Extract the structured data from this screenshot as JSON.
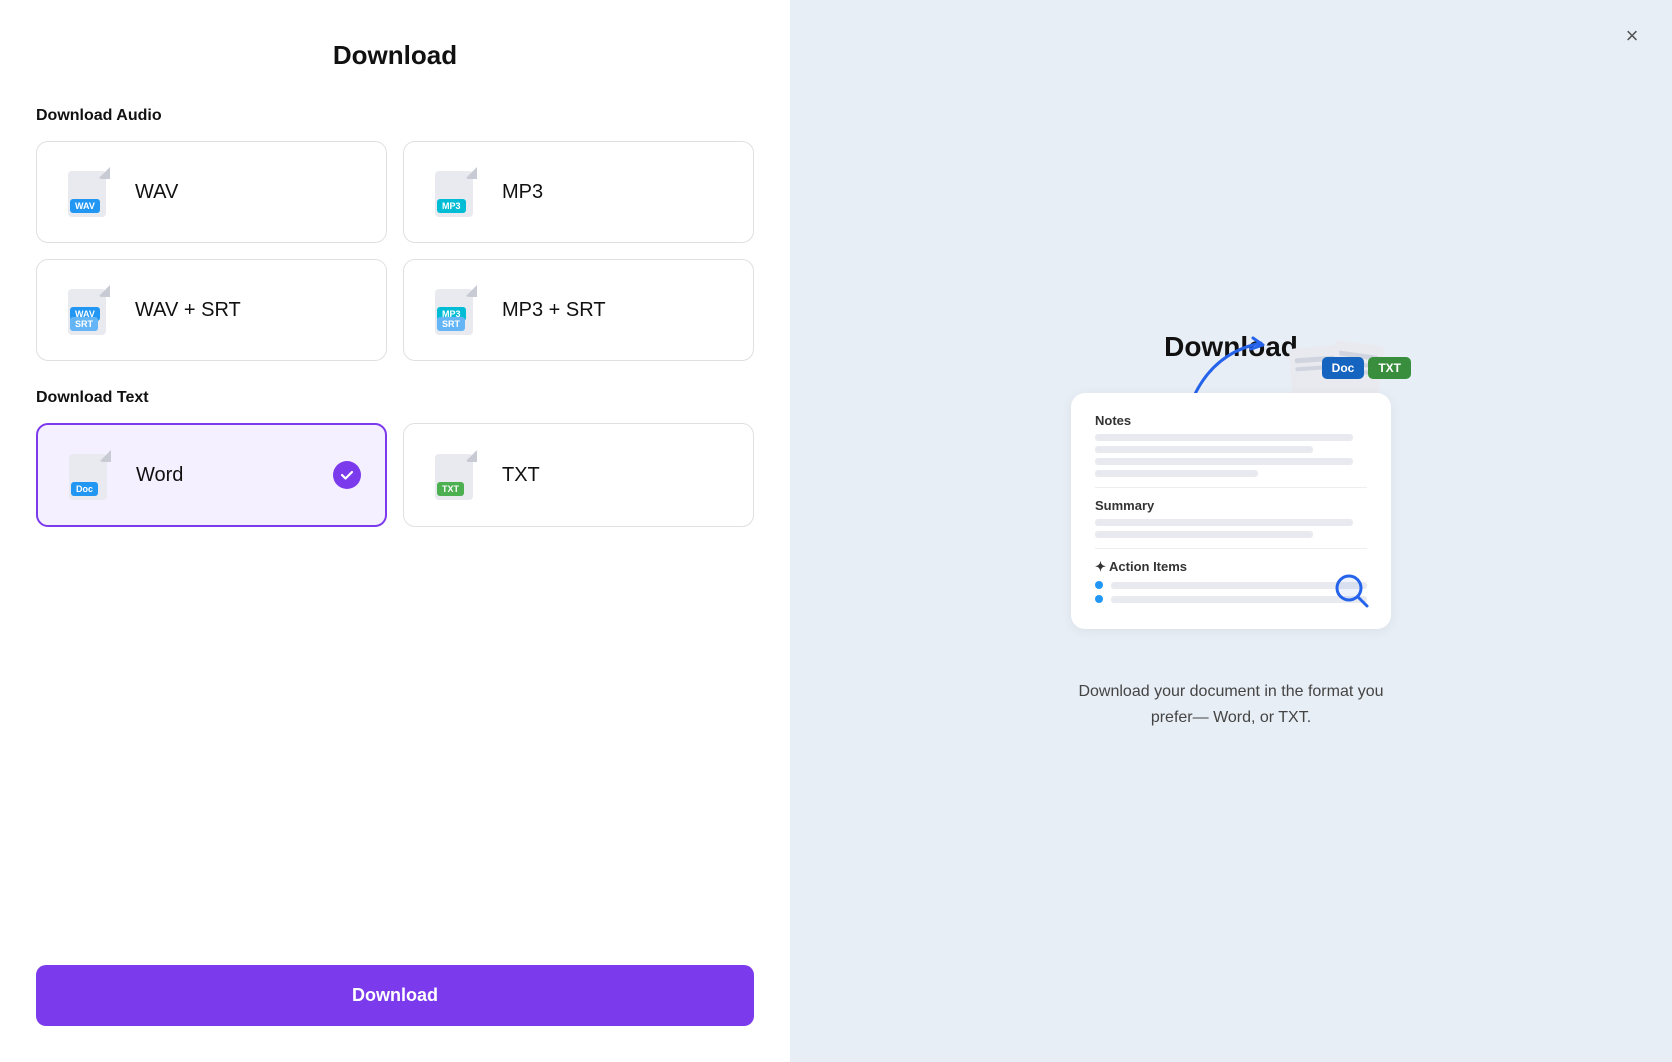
{
  "left": {
    "title": "Download",
    "audio_section": "Download Audio",
    "text_section": "Download Text",
    "formats_audio": [
      {
        "id": "wav",
        "label": "WAV",
        "badge": "WAV",
        "badge_class": "badge-wav",
        "selected": false
      },
      {
        "id": "mp3",
        "label": "MP3",
        "badge": "MP3",
        "badge_class": "badge-mp3",
        "selected": false
      },
      {
        "id": "wav-srt",
        "label": "WAV + SRT",
        "badge1": "WAV",
        "badge1_class": "badge-wav",
        "badge2": "SRT",
        "badge2_class": "badge-srt",
        "selected": false
      },
      {
        "id": "mp3-srt",
        "label": "MP3 + SRT",
        "badge1": "MP3",
        "badge1_class": "badge-mp3",
        "badge2": "SRT",
        "badge2_class": "badge-srt",
        "selected": false
      }
    ],
    "formats_text": [
      {
        "id": "word",
        "label": "Word",
        "badge": "Doc",
        "badge_class": "badge-doc",
        "selected": true
      },
      {
        "id": "txt",
        "label": "TXT",
        "badge": "TXT",
        "badge_class": "badge-txt",
        "selected": false
      }
    ],
    "download_button": "Download"
  },
  "right": {
    "title": "Download",
    "close_label": "×",
    "preview": {
      "notes_label": "Notes",
      "summary_label": "Summary",
      "action_items_label": "✦ Action Items"
    },
    "float_badge_doc": "Doc",
    "float_badge_txt": "TXT",
    "description": "Download your document in the format you prefer— Word, or TXT."
  }
}
